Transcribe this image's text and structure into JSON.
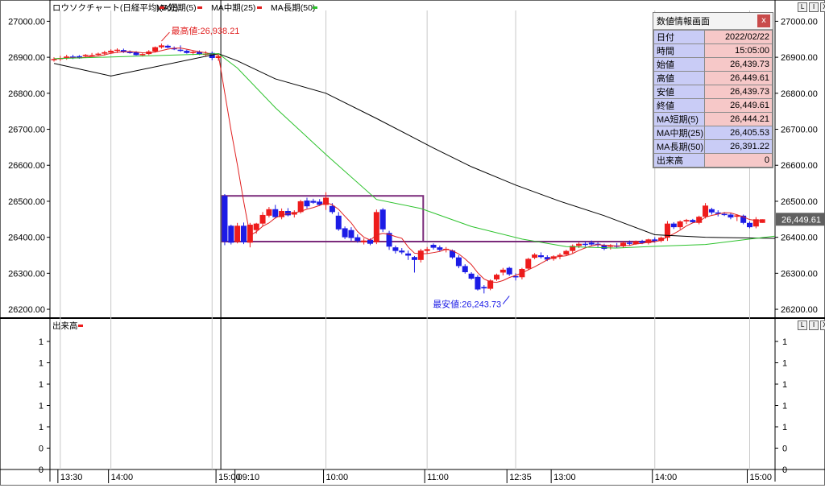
{
  "legend": {
    "title": "ロウソクチャート(日経平均)(5分)",
    "items": [
      {
        "label": "MA短期(5)",
        "color": "#e02020"
      },
      {
        "label": "MA中期(25)",
        "color": "#e02020"
      },
      {
        "label": "MA長期(50)",
        "color": "#2cc22c"
      }
    ]
  },
  "volume_label": "出来高",
  "window_buttons": [
    "L",
    "I",
    "X"
  ],
  "info_panel": {
    "title": "数値情報画面",
    "close": "x",
    "rows": [
      {
        "key": "日付",
        "value": "2022/02/22",
        "tone": "pink"
      },
      {
        "key": "時間",
        "value": "15:05:00",
        "tone": "pink"
      },
      {
        "key": "始値",
        "value": "26,439.73",
        "tone": "pink"
      },
      {
        "key": "高値",
        "value": "26,449.61",
        "tone": "pink"
      },
      {
        "key": "安値",
        "value": "26,439.73",
        "tone": "pink"
      },
      {
        "key": "終値",
        "value": "26,449.61",
        "tone": "pink"
      },
      {
        "key": "MA短期(5)",
        "value": "26,444.21",
        "tone": "pink"
      },
      {
        "key": "MA中期(25)",
        "value": "26,405.53",
        "tone": "blue"
      },
      {
        "key": "MA長期(50)",
        "value": "26,391.22",
        "tone": "blue"
      },
      {
        "key": "出来高",
        "value": "0",
        "tone": "pink"
      }
    ]
  },
  "colors": {
    "up": "#ee1c1c",
    "down": "#1c1ce6",
    "ma_short": "#e02020",
    "ma_mid": "#000000",
    "ma_long": "#2cc22c",
    "range_box": "#7a2a7a",
    "grid": "#c8c8c8",
    "annotation_high": "#e02020",
    "annotation_low": "#1c1ce6"
  },
  "chart_data": [
    {
      "type": "candlestick",
      "y_ticks": [
        "27000.00",
        "26900.00",
        "26800.00",
        "26700.00",
        "26600.00",
        "26500.00",
        "26400.00",
        "26300.00",
        "26200.00"
      ],
      "ylim": [
        26180,
        27030
      ],
      "x_labels": [
        "13:30",
        "14:00",
        "15:00",
        "09:10",
        "10:00",
        "11:00",
        "12:35",
        "13:00",
        "14:00",
        "15:00"
      ],
      "x_label_slots": [
        1,
        9,
        26,
        29,
        43,
        59,
        72,
        79,
        95,
        110
      ],
      "grid_slots": [
        1,
        9,
        25,
        43,
        59,
        73,
        95,
        110
      ],
      "session_break_slot": 26,
      "last_price_label": "26,449.61",
      "annotations": [
        {
          "text": "最高値:26,938.21",
          "value": 26938.21,
          "slot": 17,
          "color": "#e02020"
        },
        {
          "text": "最安値:26,243.73",
          "value": 26243.73,
          "slot": 72,
          "color": "#1c1ce6"
        }
      ],
      "range_box": {
        "high": 26515,
        "low": 26388,
        "slot_start": 27,
        "slot_end": 58,
        "extend_to": 95
      },
      "ohlc": [
        [
          26892,
          26900,
          26888,
          26895
        ],
        [
          26895,
          26904,
          26890,
          26898
        ],
        [
          26898,
          26907,
          26893,
          26902
        ],
        [
          26902,
          26907,
          26895,
          26899
        ],
        [
          26903,
          26906,
          26896,
          26897
        ],
        [
          26904,
          26909,
          26900,
          26907
        ],
        [
          26905,
          26912,
          26901,
          26906
        ],
        [
          26908,
          26913,
          26904,
          26910
        ],
        [
          26910,
          26918,
          26905,
          26914
        ],
        [
          26913,
          26922,
          26910,
          26918
        ],
        [
          26918,
          26925,
          26912,
          26921
        ],
        [
          26920,
          26924,
          26912,
          26914
        ],
        [
          26915,
          26919,
          26910,
          26913
        ],
        [
          26914,
          26917,
          26905,
          26906
        ],
        [
          26907,
          26912,
          26902,
          26909
        ],
        [
          26909,
          26920,
          26906,
          26916
        ],
        [
          26916,
          26930,
          26913,
          26928
        ],
        [
          26928,
          26938,
          26924,
          26933
        ],
        [
          26932,
          26935,
          26925,
          26927
        ],
        [
          26926,
          26930,
          26920,
          26922
        ],
        [
          26921,
          26933,
          26915,
          26918
        ],
        [
          26918,
          26921,
          26910,
          26912
        ],
        [
          26912,
          26918,
          26906,
          26915
        ],
        [
          26915,
          26919,
          26906,
          26908
        ],
        [
          26908,
          26917,
          26903,
          26910
        ],
        [
          26912,
          26916,
          26892,
          26898
        ],
        [
          26898,
          26906,
          26890,
          26903
        ],
        [
          26515,
          26520,
          26378,
          26388
        ],
        [
          26432,
          26435,
          26380,
          26385
        ],
        [
          26387,
          26440,
          26383,
          26432
        ],
        [
          26432,
          26441,
          26381,
          26386
        ],
        [
          26385,
          26440,
          26372,
          26435
        ],
        [
          26420,
          26440,
          26410,
          26438
        ],
        [
          26438,
          26470,
          26430,
          26462
        ],
        [
          26460,
          26484,
          26455,
          26478
        ],
        [
          26478,
          26490,
          26452,
          26456
        ],
        [
          26456,
          26480,
          26450,
          26473
        ],
        [
          26473,
          26481,
          26458,
          26461
        ],
        [
          26463,
          26475,
          26455,
          26470
        ],
        [
          26470,
          26504,
          26466,
          26500
        ],
        [
          26502,
          26510,
          26480,
          26486
        ],
        [
          26501,
          26507,
          26493,
          26496
        ],
        [
          26499,
          26506,
          26487,
          26490
        ],
        [
          26490,
          26525,
          26476,
          26510
        ],
        [
          26487,
          26495,
          26465,
          26470
        ],
        [
          26460,
          26470,
          26418,
          26422
        ],
        [
          26425,
          26430,
          26395,
          26400
        ],
        [
          26420,
          26428,
          26390,
          26398
        ],
        [
          26400,
          26408,
          26385,
          26390
        ],
        [
          26386,
          26397,
          26380,
          26391
        ],
        [
          26393,
          26397,
          26378,
          26382
        ],
        [
          26386,
          26477,
          26381,
          26470
        ],
        [
          26477,
          26481,
          26415,
          26422
        ],
        [
          26412,
          26418,
          26365,
          26374
        ],
        [
          26372,
          26377,
          26355,
          26362
        ],
        [
          26363,
          26370,
          26353,
          26358
        ],
        [
          26355,
          26363,
          26337,
          26349
        ],
        [
          26345,
          26348,
          26302,
          26337
        ],
        [
          26337,
          26368,
          26330,
          26363
        ],
        [
          26362,
          26373,
          26354,
          26367
        ],
        [
          26379,
          26383,
          26366,
          26371
        ],
        [
          26372,
          26377,
          26361,
          26365
        ],
        [
          26366,
          26373,
          26358,
          26368
        ],
        [
          26363,
          26366,
          26340,
          26344
        ],
        [
          26344,
          26350,
          26314,
          26320
        ],
        [
          26320,
          26325,
          26299,
          26303
        ],
        [
          26299,
          26303,
          26282,
          26285
        ],
        [
          26290,
          26295,
          26252,
          26255
        ],
        [
          26262,
          26267,
          26244,
          26258
        ],
        [
          26257,
          26283,
          26253,
          26280
        ],
        [
          26283,
          26299,
          26279,
          26296
        ],
        [
          26302,
          26315,
          26294,
          26310
        ],
        [
          26315,
          26318,
          26293,
          26297
        ],
        [
          26292,
          26300,
          26280,
          26289
        ],
        [
          26289,
          26315,
          26283,
          26312
        ],
        [
          26313,
          26343,
          26309,
          26340
        ],
        [
          26343,
          26356,
          26339,
          26352
        ],
        [
          26350,
          26358,
          26341,
          26345
        ],
        [
          26345,
          26350,
          26334,
          26338
        ],
        [
          26340,
          26350,
          26335,
          26347
        ],
        [
          26347,
          26356,
          26339,
          26351
        ],
        [
          26352,
          26365,
          26348,
          26362
        ],
        [
          26362,
          26380,
          26356,
          26376
        ],
        [
          26376,
          26386,
          26370,
          26382
        ],
        [
          26382,
          26389,
          26374,
          26381
        ],
        [
          26385,
          26391,
          26377,
          26380
        ],
        [
          26382,
          26386,
          26373,
          26379
        ],
        [
          26378,
          26382,
          26364,
          26368
        ],
        [
          26375,
          26381,
          26366,
          26377
        ],
        [
          26377,
          26384,
          26371,
          26375
        ],
        [
          26375,
          26389,
          26371,
          26385
        ],
        [
          26385,
          26391,
          26377,
          26382
        ],
        [
          26381,
          26391,
          26379,
          26389
        ],
        [
          26389,
          26393,
          26381,
          26384
        ],
        [
          26384,
          26396,
          26380,
          26394
        ],
        [
          26394,
          26400,
          26385,
          26390
        ],
        [
          26390,
          26402,
          26386,
          26399
        ],
        [
          26399,
          26445,
          26390,
          26438
        ],
        [
          26438,
          26442,
          26423,
          26428
        ],
        [
          26428,
          26447,
          26422,
          26444
        ],
        [
          26444,
          26451,
          26437,
          26448
        ],
        [
          26448,
          26451,
          26440,
          26442
        ],
        [
          26440,
          26460,
          26436,
          26457
        ],
        [
          26457,
          26495,
          26452,
          26488
        ],
        [
          26478,
          26482,
          26463,
          26469
        ],
        [
          26469,
          26475,
          26458,
          26465
        ],
        [
          26465,
          26470,
          26459,
          26462
        ],
        [
          26463,
          26467,
          26450,
          26455
        ],
        [
          26457,
          26464,
          26445,
          26461
        ],
        [
          26460,
          26463,
          26436,
          26440
        ],
        [
          26440,
          26444,
          26425,
          26428
        ],
        [
          26430,
          26456,
          26425,
          26450
        ],
        [
          26440,
          26450,
          26440,
          26450
        ]
      ],
      "ma_long_points": [
        [
          0,
          26896
        ],
        [
          26,
          26910
        ],
        [
          29,
          26870
        ],
        [
          35,
          26760
        ],
        [
          43,
          26630
        ],
        [
          51,
          26505
        ],
        [
          58,
          26480
        ],
        [
          66,
          26430
        ],
        [
          74,
          26395
        ],
        [
          81,
          26374
        ],
        [
          89,
          26370
        ],
        [
          95,
          26375
        ],
        [
          103,
          26380
        ],
        [
          110,
          26395
        ],
        [
          114,
          26403
        ]
      ],
      "ma_mid_points": [
        [
          0,
          26883
        ],
        [
          9,
          26848
        ],
        [
          26,
          26910
        ],
        [
          29,
          26890
        ],
        [
          35,
          26840
        ],
        [
          43,
          26800
        ],
        [
          51,
          26730
        ],
        [
          60,
          26648
        ],
        [
          66,
          26596
        ],
        [
          73,
          26545
        ],
        [
          80,
          26500
        ],
        [
          87,
          26460
        ],
        [
          95,
          26407
        ],
        [
          103,
          26400
        ],
        [
          110,
          26398
        ],
        [
          114,
          26397
        ]
      ]
    },
    {
      "type": "bar",
      "title": "出来高",
      "y_ticks": [
        "1",
        "1",
        "1",
        "1",
        "1",
        "0",
        "0",
        "0"
      ],
      "values": []
    }
  ]
}
